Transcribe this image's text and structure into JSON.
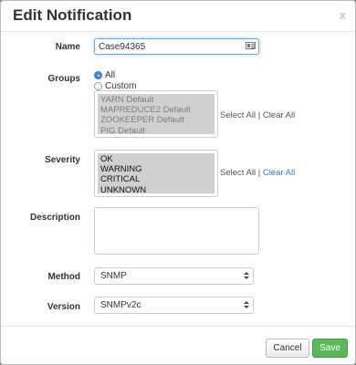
{
  "modal": {
    "title": "Edit Notification",
    "close_label": "x"
  },
  "form": {
    "name": {
      "label": "Name",
      "value": "Case94365"
    },
    "groups": {
      "label": "Groups",
      "options": [
        {
          "label": "All",
          "checked": true
        },
        {
          "label": "Custom",
          "checked": false
        }
      ],
      "items": [
        "YARN Default",
        "MAPREDUCE2 Default",
        "ZOOKEEPER Default",
        "PIG Default"
      ],
      "select_all": "Select All",
      "separator": "|",
      "clear_all": "Clear All"
    },
    "severity": {
      "label": "Severity",
      "items": [
        "OK",
        "WARNING",
        "CRITICAL",
        "UNKNOWN"
      ],
      "select_all": "Select All",
      "separator": "|",
      "clear_all": "Clear All"
    },
    "description": {
      "label": "Description",
      "value": ""
    },
    "method": {
      "label": "Method",
      "value": "SNMP"
    },
    "version": {
      "label": "Version",
      "value": "SNMPv2c"
    }
  },
  "footer": {
    "cancel_label": "Cancel",
    "save_label": "Save"
  },
  "colors": {
    "accent": "#3a8ee6",
    "save": "#5cb85c",
    "link": "#2a7fc1"
  }
}
